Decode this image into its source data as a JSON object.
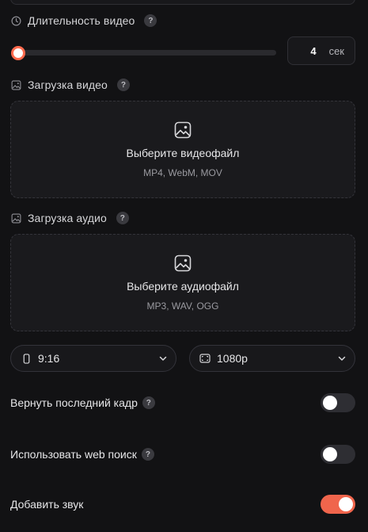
{
  "duration": {
    "label": "Длительность видео",
    "help": "?",
    "icon": "clock-icon",
    "value": "4",
    "unit": "сек",
    "slider_fraction": 0.0
  },
  "video_upload": {
    "label": "Загрузка видео",
    "help": "?",
    "icon": "image-icon",
    "title": "Выберите видеофайл",
    "formats": "MP4, WebM, MOV"
  },
  "audio_upload": {
    "label": "Загрузка аудио",
    "help": "?",
    "icon": "image-icon",
    "title": "Выберите аудиофайл",
    "formats": "MP3, WAV, OGG"
  },
  "aspect_select": {
    "value": "9:16",
    "icon": "phone-portrait-icon"
  },
  "resolution_select": {
    "value": "1080p",
    "icon": "resolution-icon"
  },
  "toggles": [
    {
      "label": "Вернуть последний кадр",
      "help": "?",
      "on": false
    },
    {
      "label": "Использовать web поиск",
      "help": "?",
      "on": false
    },
    {
      "label": "Добавить звук",
      "on": true
    }
  ],
  "colors": {
    "accent": "#f0654c",
    "background": "#121214",
    "panel": "#1a1a1d"
  }
}
